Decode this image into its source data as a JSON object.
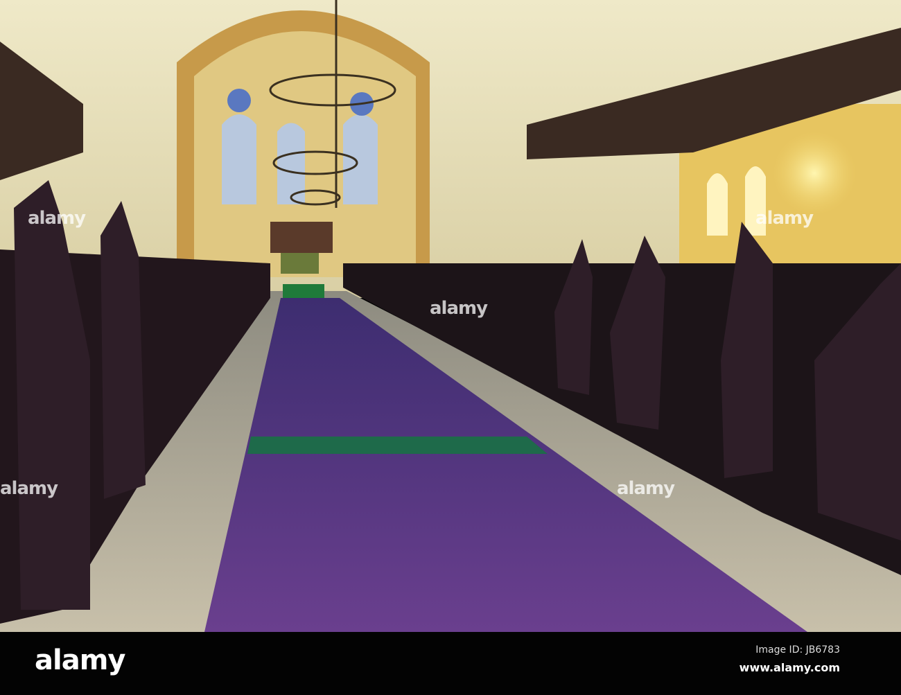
{
  "watermarks": [
    "alamy",
    "alamy",
    "alamy",
    "alamy",
    "alamy"
  ],
  "footer": {
    "logo": "alamy",
    "image_id": "Image ID: JB6783",
    "url": "www.alamy.com"
  },
  "colors": {
    "carpet": "#4a2a7a",
    "stripe": "#1e6a4a",
    "wall": "#e9e3c4",
    "pew": "#2a1a22"
  }
}
